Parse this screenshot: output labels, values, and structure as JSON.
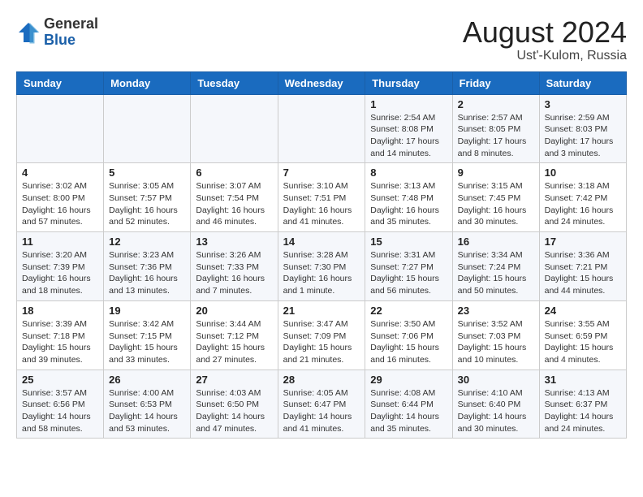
{
  "header": {
    "logo_general": "General",
    "logo_blue": "Blue",
    "month_year": "August 2024",
    "location": "Ust'-Kulom, Russia"
  },
  "weekdays": [
    "Sunday",
    "Monday",
    "Tuesday",
    "Wednesday",
    "Thursday",
    "Friday",
    "Saturday"
  ],
  "weeks": [
    [
      {
        "day": "",
        "info": ""
      },
      {
        "day": "",
        "info": ""
      },
      {
        "day": "",
        "info": ""
      },
      {
        "day": "",
        "info": ""
      },
      {
        "day": "1",
        "info": "Sunrise: 2:54 AM\nSunset: 8:08 PM\nDaylight: 17 hours\nand 14 minutes."
      },
      {
        "day": "2",
        "info": "Sunrise: 2:57 AM\nSunset: 8:05 PM\nDaylight: 17 hours\nand 8 minutes."
      },
      {
        "day": "3",
        "info": "Sunrise: 2:59 AM\nSunset: 8:03 PM\nDaylight: 17 hours\nand 3 minutes."
      }
    ],
    [
      {
        "day": "4",
        "info": "Sunrise: 3:02 AM\nSunset: 8:00 PM\nDaylight: 16 hours\nand 57 minutes."
      },
      {
        "day": "5",
        "info": "Sunrise: 3:05 AM\nSunset: 7:57 PM\nDaylight: 16 hours\nand 52 minutes."
      },
      {
        "day": "6",
        "info": "Sunrise: 3:07 AM\nSunset: 7:54 PM\nDaylight: 16 hours\nand 46 minutes."
      },
      {
        "day": "7",
        "info": "Sunrise: 3:10 AM\nSunset: 7:51 PM\nDaylight: 16 hours\nand 41 minutes."
      },
      {
        "day": "8",
        "info": "Sunrise: 3:13 AM\nSunset: 7:48 PM\nDaylight: 16 hours\nand 35 minutes."
      },
      {
        "day": "9",
        "info": "Sunrise: 3:15 AM\nSunset: 7:45 PM\nDaylight: 16 hours\nand 30 minutes."
      },
      {
        "day": "10",
        "info": "Sunrise: 3:18 AM\nSunset: 7:42 PM\nDaylight: 16 hours\nand 24 minutes."
      }
    ],
    [
      {
        "day": "11",
        "info": "Sunrise: 3:20 AM\nSunset: 7:39 PM\nDaylight: 16 hours\nand 18 minutes."
      },
      {
        "day": "12",
        "info": "Sunrise: 3:23 AM\nSunset: 7:36 PM\nDaylight: 16 hours\nand 13 minutes."
      },
      {
        "day": "13",
        "info": "Sunrise: 3:26 AM\nSunset: 7:33 PM\nDaylight: 16 hours\nand 7 minutes."
      },
      {
        "day": "14",
        "info": "Sunrise: 3:28 AM\nSunset: 7:30 PM\nDaylight: 16 hours\nand 1 minute."
      },
      {
        "day": "15",
        "info": "Sunrise: 3:31 AM\nSunset: 7:27 PM\nDaylight: 15 hours\nand 56 minutes."
      },
      {
        "day": "16",
        "info": "Sunrise: 3:34 AM\nSunset: 7:24 PM\nDaylight: 15 hours\nand 50 minutes."
      },
      {
        "day": "17",
        "info": "Sunrise: 3:36 AM\nSunset: 7:21 PM\nDaylight: 15 hours\nand 44 minutes."
      }
    ],
    [
      {
        "day": "18",
        "info": "Sunrise: 3:39 AM\nSunset: 7:18 PM\nDaylight: 15 hours\nand 39 minutes."
      },
      {
        "day": "19",
        "info": "Sunrise: 3:42 AM\nSunset: 7:15 PM\nDaylight: 15 hours\nand 33 minutes."
      },
      {
        "day": "20",
        "info": "Sunrise: 3:44 AM\nSunset: 7:12 PM\nDaylight: 15 hours\nand 27 minutes."
      },
      {
        "day": "21",
        "info": "Sunrise: 3:47 AM\nSunset: 7:09 PM\nDaylight: 15 hours\nand 21 minutes."
      },
      {
        "day": "22",
        "info": "Sunrise: 3:50 AM\nSunset: 7:06 PM\nDaylight: 15 hours\nand 16 minutes."
      },
      {
        "day": "23",
        "info": "Sunrise: 3:52 AM\nSunset: 7:03 PM\nDaylight: 15 hours\nand 10 minutes."
      },
      {
        "day": "24",
        "info": "Sunrise: 3:55 AM\nSunset: 6:59 PM\nDaylight: 15 hours\nand 4 minutes."
      }
    ],
    [
      {
        "day": "25",
        "info": "Sunrise: 3:57 AM\nSunset: 6:56 PM\nDaylight: 14 hours\nand 58 minutes."
      },
      {
        "day": "26",
        "info": "Sunrise: 4:00 AM\nSunset: 6:53 PM\nDaylight: 14 hours\nand 53 minutes."
      },
      {
        "day": "27",
        "info": "Sunrise: 4:03 AM\nSunset: 6:50 PM\nDaylight: 14 hours\nand 47 minutes."
      },
      {
        "day": "28",
        "info": "Sunrise: 4:05 AM\nSunset: 6:47 PM\nDaylight: 14 hours\nand 41 minutes."
      },
      {
        "day": "29",
        "info": "Sunrise: 4:08 AM\nSunset: 6:44 PM\nDaylight: 14 hours\nand 35 minutes."
      },
      {
        "day": "30",
        "info": "Sunrise: 4:10 AM\nSunset: 6:40 PM\nDaylight: 14 hours\nand 30 minutes."
      },
      {
        "day": "31",
        "info": "Sunrise: 4:13 AM\nSunset: 6:37 PM\nDaylight: 14 hours\nand 24 minutes."
      }
    ]
  ]
}
